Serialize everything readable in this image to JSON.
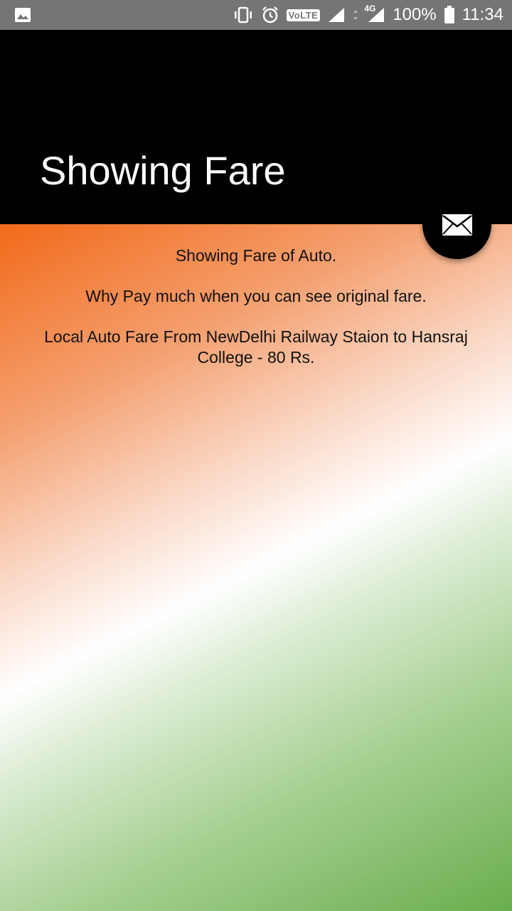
{
  "status_bar": {
    "battery_percent": "100%",
    "time": "11:34",
    "volte_label": "VoLTE",
    "network_label": "4G",
    "icons": [
      "image-icon",
      "vibrate-icon",
      "alarm-icon",
      "volte-icon",
      "signal-icon",
      "data-arrows-icon",
      "signal-4g-icon",
      "battery-icon"
    ]
  },
  "app_bar": {
    "title": "Showing Fare"
  },
  "content": {
    "line1": "Showing Fare of Auto.",
    "line2": "Why Pay much when you can see original fare.",
    "line3": "Local Auto Fare From NewDelhi Railway Staion to Hansraj College - 80 Rs."
  },
  "fab": {
    "icon": "email-icon"
  },
  "colors": {
    "status_bar": "#757575",
    "app_bar": "#000000",
    "gradient_top": "#f26a1a",
    "gradient_middle": "#ffffff",
    "gradient_bottom": "#6aae4e",
    "fab": "#000000"
  }
}
